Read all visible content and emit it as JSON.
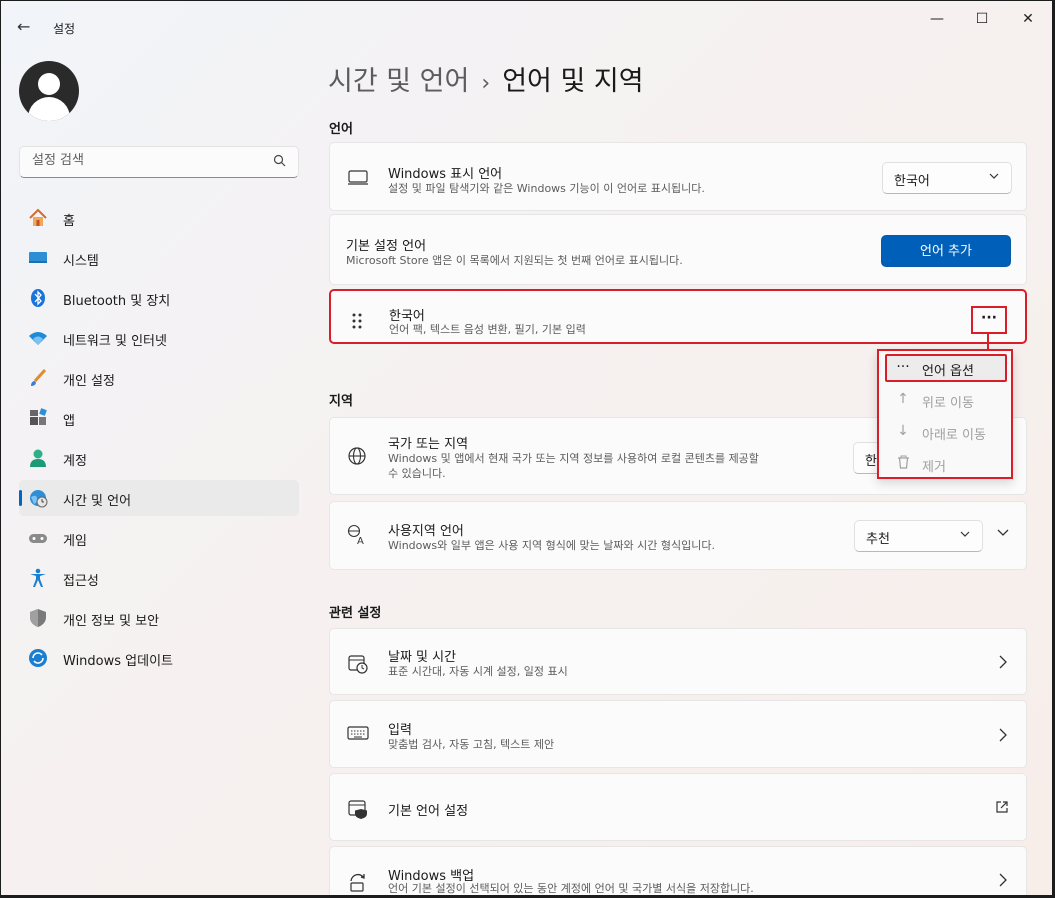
{
  "window": {
    "app_title": "설정",
    "buttons": {
      "minimize": "—",
      "maximize": "☐",
      "close": "✕"
    },
    "back_icon": "←"
  },
  "sidebar": {
    "search_placeholder": "설정 검색",
    "items": [
      {
        "label": "홈",
        "icon": "home-icon"
      },
      {
        "label": "시스템",
        "icon": "system-icon"
      },
      {
        "label": "Bluetooth 및 장치",
        "icon": "bluetooth-icon"
      },
      {
        "label": "네트워크 및 인터넷",
        "icon": "wifi-icon"
      },
      {
        "label": "개인 설정",
        "icon": "brush-icon"
      },
      {
        "label": "앱",
        "icon": "apps-icon"
      },
      {
        "label": "계정",
        "icon": "account-icon"
      },
      {
        "label": "시간 및 언어",
        "icon": "time-language-icon",
        "active": true
      },
      {
        "label": "게임",
        "icon": "gamepad-icon"
      },
      {
        "label": "접근성",
        "icon": "accessibility-icon"
      },
      {
        "label": "개인 정보 및 보안",
        "icon": "shield-icon"
      },
      {
        "label": "Windows 업데이트",
        "icon": "update-icon"
      }
    ]
  },
  "breadcrumb": {
    "parent": "시간 및 언어",
    "separator": "›",
    "current": "언어 및 지역"
  },
  "language_section": {
    "title": "언어",
    "display_language": {
      "title": "Windows 표시 언어",
      "desc": "설정 및 파일 탐색기와 같은 Windows 기능이 이 언어로 표시됩니다.",
      "value": "한국어"
    },
    "preferred": {
      "title": "기본 설정 언어",
      "desc": "Microsoft Store 앱은 이 목록에서 지원되는 첫 번째 언어로 표시됩니다.",
      "add_button": "언어 추가"
    },
    "korean": {
      "title": "한국어",
      "desc": "언어 팩, 텍스트 음성 변환, 필기, 기본 입력",
      "more": "···"
    }
  },
  "context_menu": {
    "items": [
      {
        "icon": "···",
        "label": "언어 옵션",
        "enabled": true
      },
      {
        "icon": "↑",
        "label": "위로 이동",
        "enabled": false
      },
      {
        "icon": "↓",
        "label": "아래로 이동",
        "enabled": false
      },
      {
        "icon": "🗑",
        "label": "제거",
        "enabled": false
      }
    ]
  },
  "region_section": {
    "title": "지역",
    "country": {
      "title": "국가 또는 지역",
      "desc_line1": "Windows 및 앱에서 현재 국가 또는 지역 정보를 사용하여 로컬 콘텐츠를 제공할",
      "desc_line2": "수 있습니다.",
      "value_partial": "한"
    },
    "regional_format": {
      "title": "사용지역 언어",
      "desc": "Windows와 일부 앱은 사용 지역 형식에 맞는 날짜와 시간 형식입니다.",
      "value": "추천"
    }
  },
  "related_section": {
    "title": "관련 설정",
    "items": [
      {
        "title": "날짜 및 시간",
        "desc": "표준 시간대, 자동 시계 설정, 일정 표시",
        "icon": "clock-calendar-icon"
      },
      {
        "title": "입력",
        "desc": "맞춤법 검사, 자동 고침, 텍스트 제안",
        "icon": "keyboard-icon"
      },
      {
        "title": "기본 언어 설정",
        "desc": "",
        "icon": "admin-language-icon"
      },
      {
        "title": "Windows 백업",
        "desc": "언어 기본 설정이 선택되어 있는 동안 계정에 언어 및 국가별 서식을 저장합니다.",
        "icon": "backup-icon"
      }
    ]
  }
}
